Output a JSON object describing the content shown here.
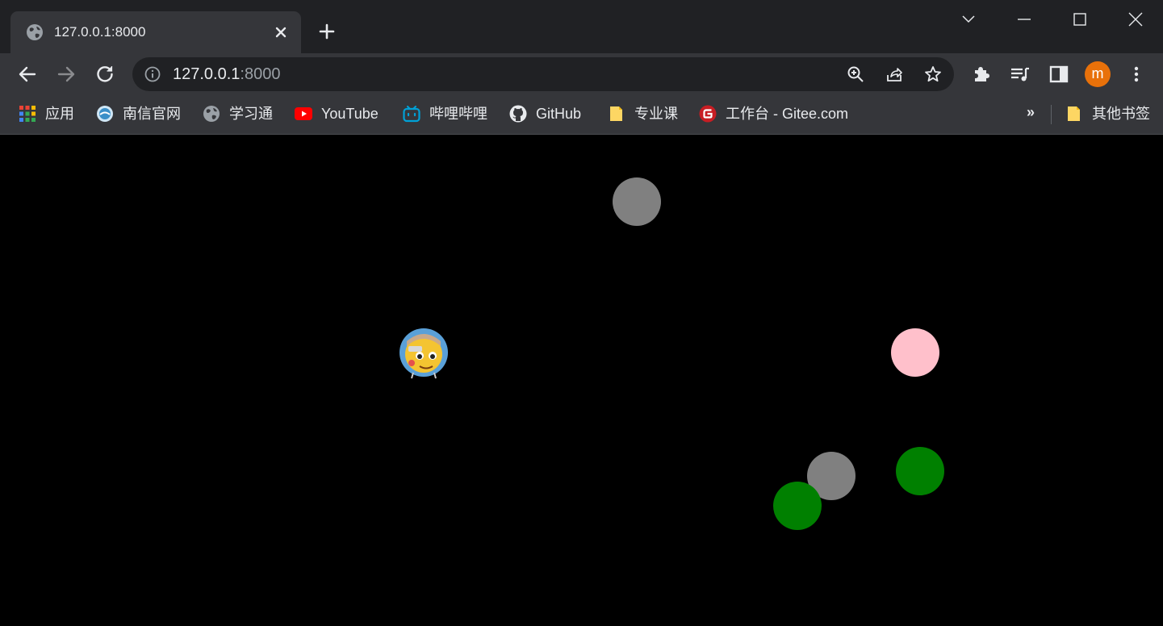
{
  "browser": {
    "tab": {
      "title": "127.0.0.1:8000",
      "favicon": "globe-icon"
    },
    "new_tab_icon": "plus-icon",
    "window_controls": [
      "tab-search-icon",
      "minimize-icon",
      "maximize-icon",
      "close-icon"
    ],
    "toolbar": {
      "buttons": [
        "back-icon",
        "forward-icon",
        "reload-icon"
      ],
      "address": {
        "host": "127.0.0.1",
        "port": ":8000",
        "info_icon": "info-icon"
      },
      "omnibox_icons": [
        "zoom-icon",
        "share-icon",
        "star-icon"
      ],
      "extensions": [
        "puzzle-icon",
        "reading-list-icon",
        "side-panel-icon"
      ],
      "profile_initial": "m",
      "menu_icon": "kebab-menu-icon"
    },
    "bookmarks": [
      {
        "label": "应用",
        "icon": "apps-grid-icon"
      },
      {
        "label": "南信官网",
        "icon": "nuist-logo-icon"
      },
      {
        "label": "学习通",
        "icon": "globe-icon"
      },
      {
        "label": "YouTube",
        "icon": "youtube-icon"
      },
      {
        "label": "哔哩哔哩",
        "icon": "bilibili-icon"
      },
      {
        "label": "GitHub",
        "icon": "github-icon"
      },
      {
        "label": "专业课",
        "icon": "folder-icon"
      },
      {
        "label": "工作台 - Gitee.com",
        "icon": "gitee-icon"
      }
    ],
    "bookmarks_overflow": "»",
    "other_bookmarks": {
      "label": "其他书签",
      "icon": "folder-icon"
    }
  },
  "game": {
    "background": "#000000",
    "player": {
      "icon": "player-avatar-icon"
    },
    "balls": [
      {
        "color": "#808080"
      },
      {
        "color": "#ffc0cb"
      },
      {
        "color": "#808080"
      },
      {
        "color": "#008000"
      },
      {
        "color": "#008000"
      }
    ]
  }
}
